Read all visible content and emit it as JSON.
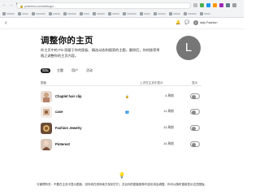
{
  "browser": {
    "url": "pinterest.com/settings/...",
    "bookmark_count": 14
  },
  "header": {
    "avatar_letter": "L",
    "username": "lady Fashion"
  },
  "page": {
    "title": "调整你的主页",
    "description": "你主页中的 Pin 图基于你的图板、精选动态和搜索的主题。删除后，你的推荐将随之调整你的主页内容。",
    "avatar_letter": "L"
  },
  "tabs": [
    {
      "label": "图板",
      "active": true
    },
    {
      "label": "主题",
      "active": false
    },
    {
      "label": "用户",
      "active": false
    },
    {
      "label": "活动",
      "active": false
    }
  ],
  "table": {
    "col_board": "图板",
    "col_updated": "上次在主页中显示",
    "col_show": "显示",
    "rows": [
      {
        "name": "Chaplet hair clip",
        "icon": "lock-icon",
        "count": "4 周前"
      },
      {
        "name": "case",
        "icon": "group-icon",
        "count": "11 周前"
      },
      {
        "name": "Fashion Jewelry",
        "icon": "",
        "count": "13 周前"
      },
      {
        "name": "Pinterest",
        "icon": "",
        "count": "14 周前"
      }
    ]
  },
  "footer": {
    "text": "与管理有关：不要在主页中显示图板，但你将在其他地方找到它们，并且你的图板推荐内容也将会调整。你可以随时重新显示这些图板。"
  },
  "colors": {
    "active_tab": "#111111",
    "avatar": "#767676"
  }
}
